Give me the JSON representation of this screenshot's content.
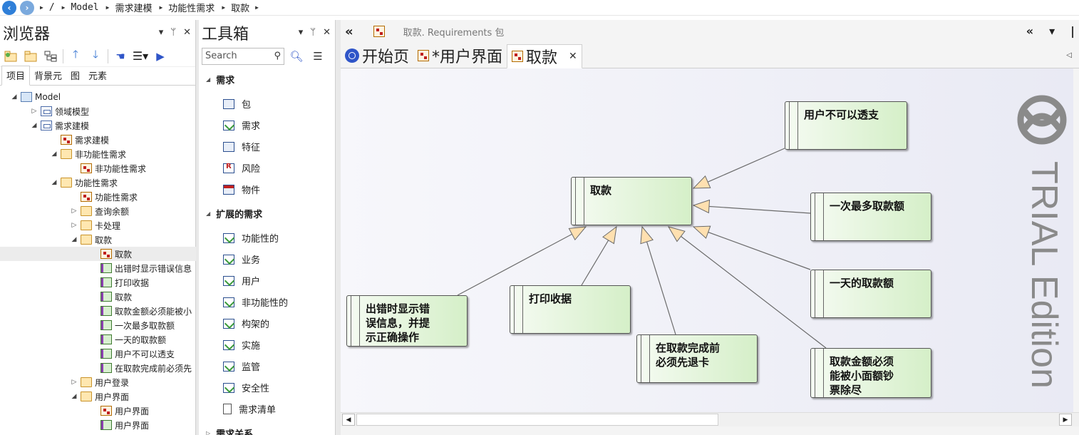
{
  "breadcrumb": {
    "items": [
      "/",
      "Model",
      "需求建模",
      "功能性需求",
      "取款"
    ]
  },
  "browser": {
    "title": "浏览器",
    "tabs": [
      "项目",
      "背景元",
      "图",
      "元素"
    ],
    "tree": [
      {
        "label": "Model",
        "icon": "model",
        "level": 0,
        "exp": "open"
      },
      {
        "label": "领域模型",
        "icon": "pkg",
        "level": 1,
        "exp": "closed"
      },
      {
        "label": "需求建模",
        "icon": "pkg",
        "level": 1,
        "exp": "open"
      },
      {
        "label": "需求建模",
        "icon": "diag",
        "level": 2,
        "exp": "none"
      },
      {
        "label": "非功能性需求",
        "icon": "folder",
        "level": 2,
        "exp": "open"
      },
      {
        "label": "非功能性需求",
        "icon": "diag",
        "level": 3,
        "exp": "none"
      },
      {
        "label": "功能性需求",
        "icon": "folder",
        "level": 2,
        "exp": "open"
      },
      {
        "label": "功能性需求",
        "icon": "diag",
        "level": 3,
        "exp": "none"
      },
      {
        "label": "查询余额",
        "icon": "folder",
        "level": 3,
        "exp": "closed"
      },
      {
        "label": "卡处理",
        "icon": "folder",
        "level": 3,
        "exp": "closed"
      },
      {
        "label": "取款",
        "icon": "folder",
        "level": 3,
        "exp": "open"
      },
      {
        "label": "取款",
        "icon": "diag",
        "level": 4,
        "exp": "none",
        "selected": true
      },
      {
        "label": "出错时显示错误信息",
        "icon": "req",
        "level": 4,
        "exp": "none"
      },
      {
        "label": "打印收据",
        "icon": "req",
        "level": 4,
        "exp": "none"
      },
      {
        "label": "取款",
        "icon": "req",
        "level": 4,
        "exp": "none"
      },
      {
        "label": "取款金额必须能被小",
        "icon": "req",
        "level": 4,
        "exp": "none"
      },
      {
        "label": "一次最多取款额",
        "icon": "req",
        "level": 4,
        "exp": "none"
      },
      {
        "label": "一天的取款额",
        "icon": "req",
        "level": 4,
        "exp": "none"
      },
      {
        "label": "用户不可以透支",
        "icon": "req",
        "level": 4,
        "exp": "none"
      },
      {
        "label": "在取款完成前必须先",
        "icon": "req",
        "level": 4,
        "exp": "none"
      },
      {
        "label": "用户登录",
        "icon": "folder",
        "level": 3,
        "exp": "closed"
      },
      {
        "label": "用户界面",
        "icon": "folder",
        "level": 3,
        "exp": "open"
      },
      {
        "label": "用户界面",
        "icon": "diag",
        "level": 4,
        "exp": "none"
      },
      {
        "label": "用户界面",
        "icon": "req",
        "level": 4,
        "exp": "none"
      }
    ]
  },
  "toolbox": {
    "title": "工具箱",
    "search_placeholder": "Search",
    "groups": [
      {
        "label": "需求",
        "items": [
          {
            "label": "包",
            "icon": "pkg"
          },
          {
            "label": "需求",
            "icon": "r"
          },
          {
            "label": "特征",
            "icon": "feat"
          },
          {
            "label": "风险",
            "icon": "risk"
          },
          {
            "label": "物件",
            "icon": "art"
          }
        ]
      },
      {
        "label": "扩展的需求",
        "items": [
          {
            "label": "功能性的",
            "icon": "r"
          },
          {
            "label": "业务",
            "icon": "r"
          },
          {
            "label": "用户",
            "icon": "r"
          },
          {
            "label": "非功能性的",
            "icon": "r"
          },
          {
            "label": "构架的",
            "icon": "r"
          },
          {
            "label": "实施",
            "icon": "r"
          },
          {
            "label": "监管",
            "icon": "r"
          },
          {
            "label": "安全性",
            "icon": "r"
          },
          {
            "label": "需求清单",
            "icon": "doc"
          }
        ]
      },
      {
        "label": "需求关系",
        "items": []
      }
    ]
  },
  "diagram_header": {
    "collapse_label": "«",
    "title": "取款.",
    "subtitle": "Requirements 包",
    "right_controls": [
      "«",
      "▾",
      "|"
    ]
  },
  "doc_tabs": [
    {
      "label": "开始页",
      "icon": "start"
    },
    {
      "label": "*用户界面",
      "icon": "diagram"
    },
    {
      "label": "取款",
      "icon": "diagram",
      "active": true,
      "close": "✕"
    }
  ],
  "diagram": {
    "nodes": [
      {
        "id": "main",
        "label": "取款"
      },
      {
        "id": "n1",
        "label": "用户不可以透支"
      },
      {
        "id": "n2",
        "label": "一次最多取款额"
      },
      {
        "id": "n3",
        "label": "一天的取款额"
      },
      {
        "id": "n4",
        "label": "取款金额必须\n能被小面额钞\n票除尽"
      },
      {
        "id": "n5",
        "label": "在取款完成前\n必须先退卡"
      },
      {
        "id": "n6",
        "label": "打印收据"
      },
      {
        "id": "n7",
        "label": "出错时显示错\n误信息，并提\n示正确操作"
      }
    ],
    "watermark": "TRIAL Edition"
  },
  "colors": {
    "accent": "#2f7fd8",
    "node_fill_start": "#f5fbf2",
    "node_fill_end": "#d5efc8",
    "watermark": "#8a8a8a"
  }
}
